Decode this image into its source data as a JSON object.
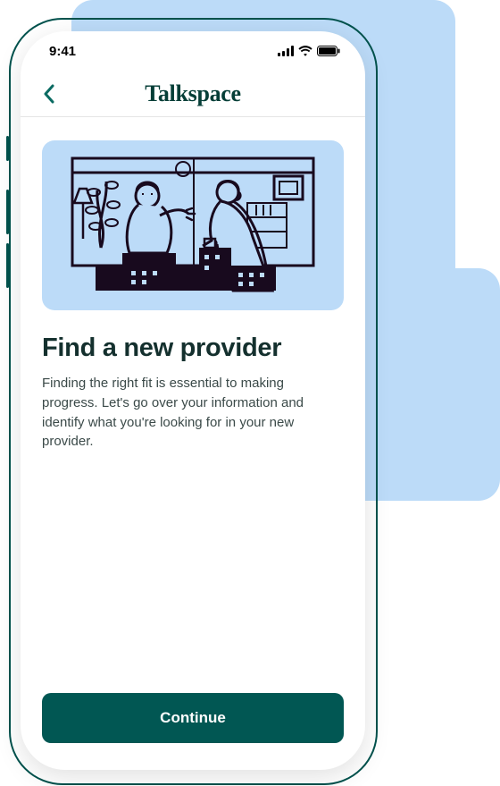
{
  "status_bar": {
    "time": "9:41"
  },
  "nav": {
    "brand": "Talkspace"
  },
  "page": {
    "title": "Find a new provider",
    "body": "Finding the right fit is essential to making progress. Let's go over your information and identify what you're looking for in your new provider."
  },
  "cta": {
    "continue_label": "Continue"
  },
  "colors": {
    "accent": "#015753",
    "illustration_bg": "#bcdbf8",
    "illustration_ink": "#180a1e"
  }
}
